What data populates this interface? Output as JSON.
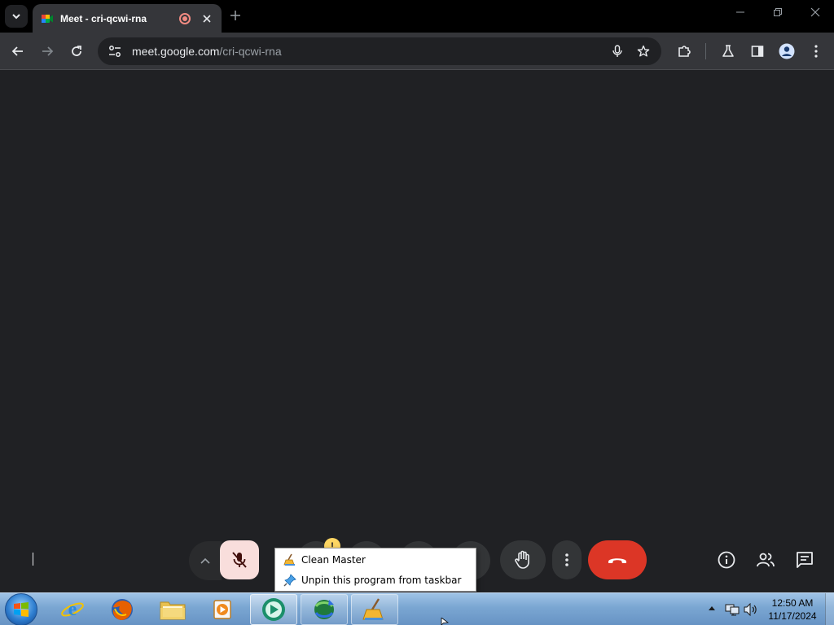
{
  "browser": {
    "tab": {
      "title": "Meet - cri-qcwi-rna"
    },
    "address": {
      "host": "meet.google.com",
      "path": "/cri-qcwi-rna"
    }
  },
  "jumplist": {
    "items": [
      {
        "label": "Clean Master"
      },
      {
        "label": "Unpin this program from taskbar"
      }
    ]
  },
  "taskbar": {
    "clock_time": "12:50 AM",
    "clock_date": "11/17/2024"
  },
  "colors": {
    "meet_bg": "#202124",
    "end_call": "#dc3626",
    "mic_off_bg": "#f9dedc",
    "warning": "#fdd663"
  }
}
